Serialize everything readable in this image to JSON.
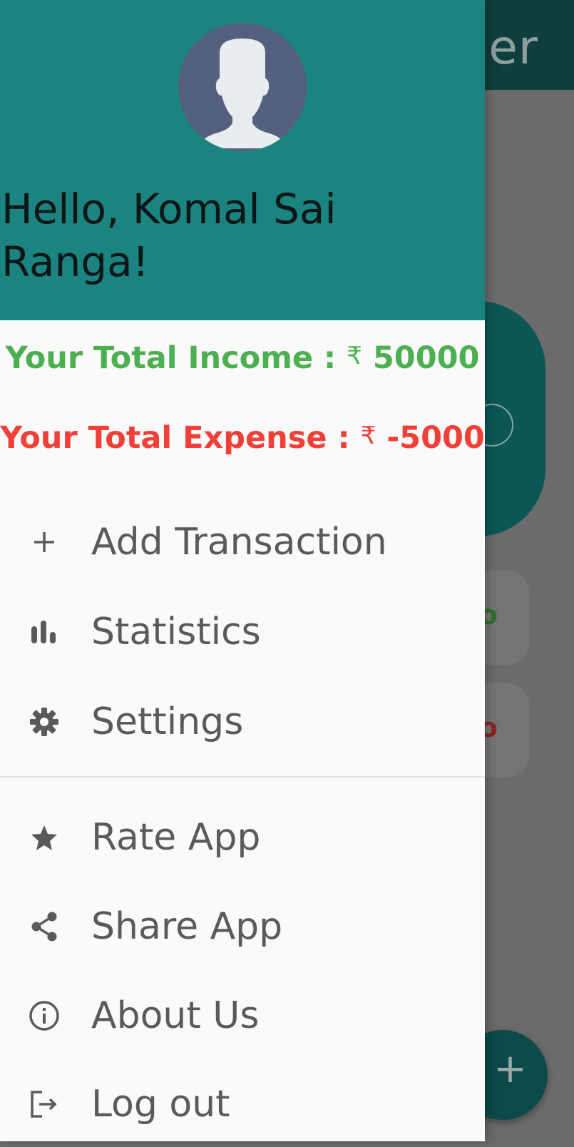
{
  "background": {
    "toolbar_title_fragment": "er",
    "income_fragment": "o",
    "expense_fragment": "o",
    "fab_icon": "plus-icon",
    "fab_symbol": "+"
  },
  "drawer": {
    "avatar_icon": "default-avatar-icon",
    "greeting": "Hello, Komal Sai Ranga!",
    "income": {
      "label": "Your Total Income : ",
      "currency": "₹",
      "amount": "50000",
      "color": "#4caf50"
    },
    "expense": {
      "label": "Your Total Expense : ",
      "currency": "₹",
      "amount": "-5000",
      "color": "#f04037"
    },
    "menu_primary": [
      {
        "label": "Add Transaction",
        "icon": "plus-icon"
      },
      {
        "label": "Statistics",
        "icon": "bar-chart-icon"
      },
      {
        "label": "Settings",
        "icon": "gear-icon"
      }
    ],
    "menu_secondary": [
      {
        "label": "Rate App",
        "icon": "star-icon"
      },
      {
        "label": "Share App",
        "icon": "share-icon"
      },
      {
        "label": "About Us",
        "icon": "info-icon"
      },
      {
        "label": "Log out",
        "icon": "logout-icon"
      }
    ]
  },
  "colors": {
    "header_teal": "#1b8480",
    "icon_gray": "#5a5a5a",
    "drawer_bg": "#fafafa"
  }
}
